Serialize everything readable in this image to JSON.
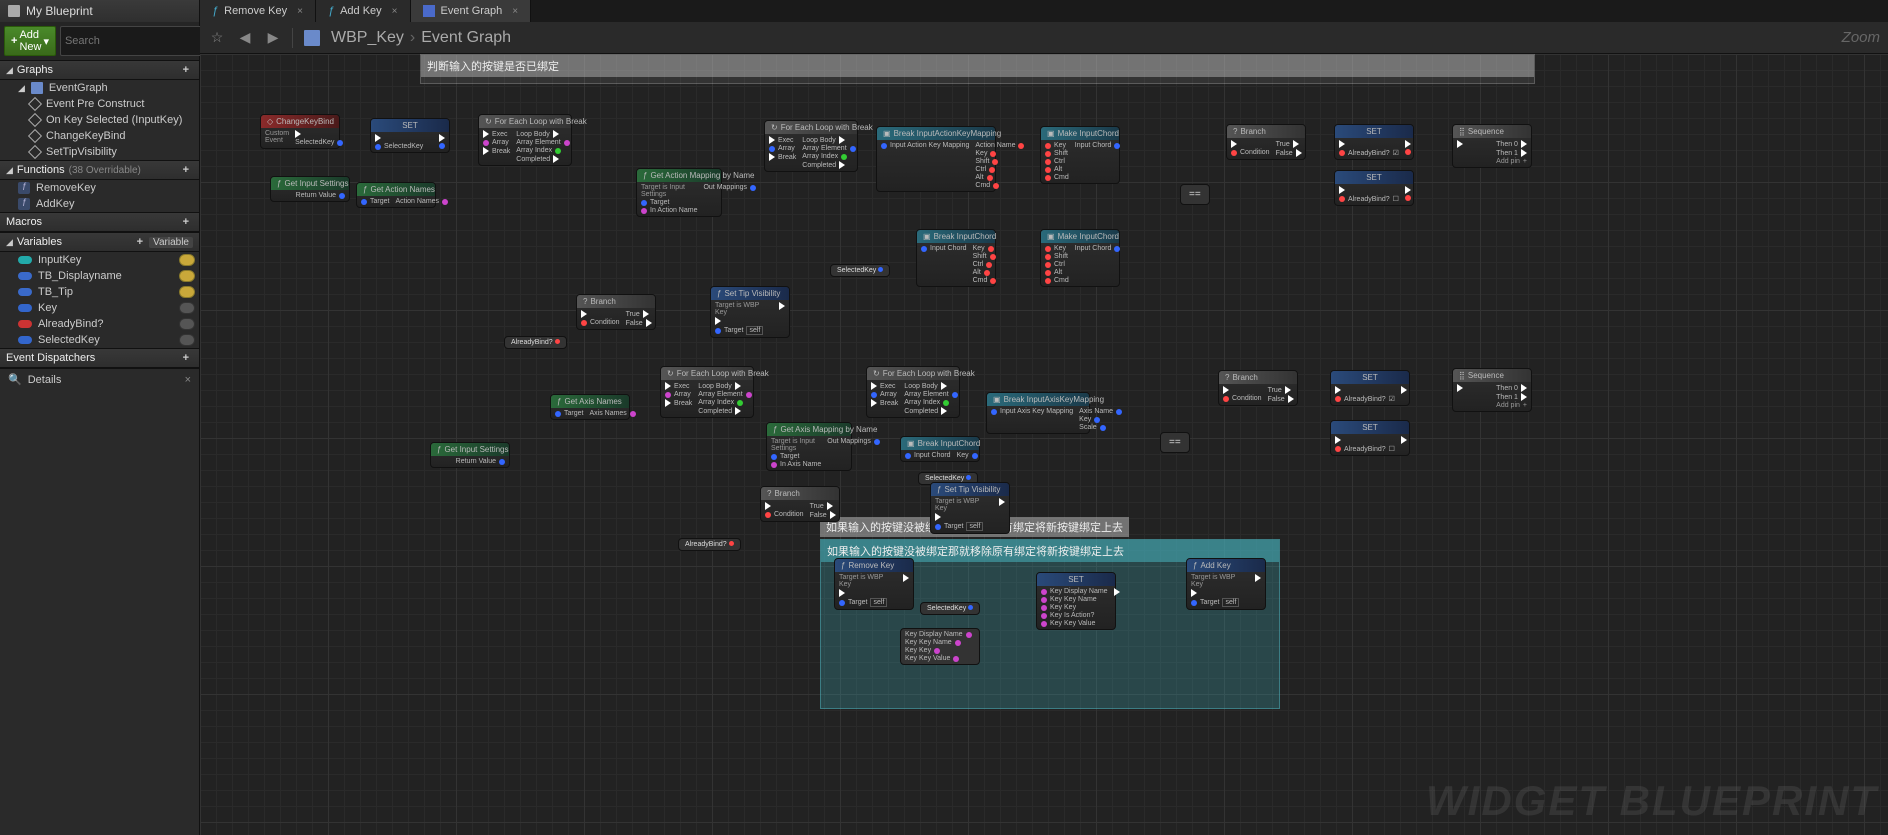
{
  "panel": {
    "title": "My Blueprint",
    "addNew": "Add New",
    "searchPlaceholder": "Search"
  },
  "sections": {
    "graphs": "Graphs",
    "functions": "Functions",
    "functionsCount": "(38 Overridable)",
    "macros": "Macros",
    "variables": "Variables",
    "variableBtn": "Variable",
    "dispatchers": "Event Dispatchers"
  },
  "graphTree": {
    "root": "EventGraph",
    "items": [
      "Event Pre Construct",
      "On Key Selected (InputKey)",
      "ChangeKeyBind",
      "SetTipVisibility"
    ]
  },
  "funcs": [
    "RemoveKey",
    "AddKey"
  ],
  "vars": [
    {
      "name": "InputKey",
      "color": "cyan",
      "eye": true
    },
    {
      "name": "TB_Displayname",
      "color": "txt",
      "eye": true
    },
    {
      "name": "TB_Tip",
      "color": "txt",
      "eye": true
    },
    {
      "name": "Key",
      "color": "blue",
      "eye": false
    },
    {
      "name": "AlreadyBind?",
      "color": "red",
      "eye": false
    },
    {
      "name": "SelectedKey",
      "color": "blue",
      "eye": false
    }
  ],
  "details": "Details",
  "tabs": [
    {
      "label": "Remove Key",
      "type": "f"
    },
    {
      "label": "Add Key",
      "type": "f"
    },
    {
      "label": "Event Graph",
      "type": "g",
      "active": true
    }
  ],
  "breadcrumb": {
    "a": "WBP_Key",
    "b": "Event Graph"
  },
  "zoom": "Zoom",
  "watermark": "WIDGET BLUEPRINT",
  "comments": {
    "c1": "判断输入的按键是否已绑定",
    "c2": "如果输入的按键没被绑定那就移除原有绑定将新按键绑定上去",
    "c3": "如果输入的按键没被绑定那就移除原有绑定将新按键绑定上去"
  },
  "nodes": {
    "changeKeyBind": {
      "title": "ChangeKeyBind",
      "sub": "Custom Event",
      "out": "SelectedKey"
    },
    "set1": {
      "title": "SET",
      "pin": "SelectedKey"
    },
    "getInputSettings1": {
      "title": "Get Input Settings",
      "out": "Return Value"
    },
    "getActionNames": {
      "title": "Get Action Names",
      "in": "Target",
      "out": "Action Names"
    },
    "forEach1": {
      "title": "For Each Loop with Break",
      "pins": {
        "exec": "Exec",
        "array": "Array",
        "break": "Break",
        "loopBody": "Loop Body",
        "elem": "Array Element",
        "idx": "Array Index",
        "comp": "Completed"
      }
    },
    "getActionMapping": {
      "title": "Get Action Mapping by Name",
      "sub": "Target is Input Settings",
      "in1": "Target",
      "in2": "In Action Name",
      "out": "Out Mappings"
    },
    "branch1": {
      "title": "Branch",
      "cond": "Condition",
      "t": "True",
      "f": "False"
    },
    "alreadyBind": "AlreadyBind?",
    "setTipVis1": {
      "title": "Set Tip Visibility",
      "sub": "Target is WBP Key",
      "in": "Target"
    },
    "forEach2": {
      "title": "For Each Loop with Break"
    },
    "breakIAKM": {
      "title": "Break InputActionKeyMapping",
      "in": "Input Action Key Mapping",
      "outs": [
        "Action Name",
        "Key",
        "Shift",
        "Ctrl",
        "Alt",
        "Cmd"
      ]
    },
    "makeIC1": {
      "title": "Make InputChord",
      "ins": [
        "Key",
        "Shift",
        "Ctrl",
        "Alt",
        "Cmd"
      ],
      "out": "Input Chord"
    },
    "breakIC1": {
      "title": "Break InputChord",
      "in": "Input Chord",
      "outs": [
        "Key",
        "Shift",
        "Ctrl",
        "Alt",
        "Cmd"
      ]
    },
    "makeIC2": {
      "title": "Make InputChord"
    },
    "selectedKey": "SelectedKey",
    "eqeq": "==",
    "branch2": {
      "title": "Branch"
    },
    "setAB1": {
      "title": "SET",
      "pin": "AlreadyBind?"
    },
    "setAB2": {
      "title": "SET",
      "pin": "AlreadyBind?"
    },
    "sequence1": {
      "title": "Sequence",
      "outs": [
        "Then 0",
        "Then 1"
      ],
      "add": "Add pin"
    },
    "getInputSettings2": {
      "title": "Get Input Settings",
      "out": "Return Value"
    },
    "getAxisNames": {
      "title": "Get Axis Names",
      "in": "Target",
      "out": "Axis Names"
    },
    "forEach3": {
      "title": "For Each Loop with Break"
    },
    "getAxisMapping": {
      "title": "Get Axis Mapping by Name",
      "sub": "Target is Input Settings",
      "in1": "Target",
      "in2": "In Axis Name",
      "out": "Out Mappings"
    },
    "forEach4": {
      "title": "For Each Loop with Break"
    },
    "breakIAxKM": {
      "title": "Break InputAxisKeyMapping",
      "in": "Input Axis Key Mapping",
      "outs": [
        "Axis Name",
        "Key",
        "Scale"
      ]
    },
    "breakIC2": {
      "title": "Break InputChord",
      "in": "Input Chord",
      "out": "Key"
    },
    "selectedKey2": "SelectedKey",
    "branch3": {
      "title": "Branch"
    },
    "setTipVis2": {
      "title": "Set Tip Visibility",
      "sub": "Target is WBP Key",
      "in": "Target"
    },
    "branch4": {
      "title": "Branch"
    },
    "setAB3": {
      "title": "SET",
      "pin": "AlreadyBind?"
    },
    "setAB4": {
      "title": "SET",
      "pin": "AlreadyBind?"
    },
    "sequence2": {
      "title": "Sequence"
    },
    "removeKey": {
      "title": "Remove Key",
      "sub": "Target is WBP Key",
      "in": "Target"
    },
    "addKey": {
      "title": "Add Key",
      "sub": "Target is WBP Key",
      "in": "Target"
    },
    "setBig": {
      "title": "SET",
      "pins": [
        "Key Display Name",
        "Key Key Name",
        "Key Key",
        "Key Is Action?",
        "Key Key Value"
      ]
    },
    "pillNode": {
      "pins": [
        "Key Display Name",
        "Key Key Name",
        "Key Key",
        "Key Key Value"
      ]
    },
    "self": "self"
  }
}
